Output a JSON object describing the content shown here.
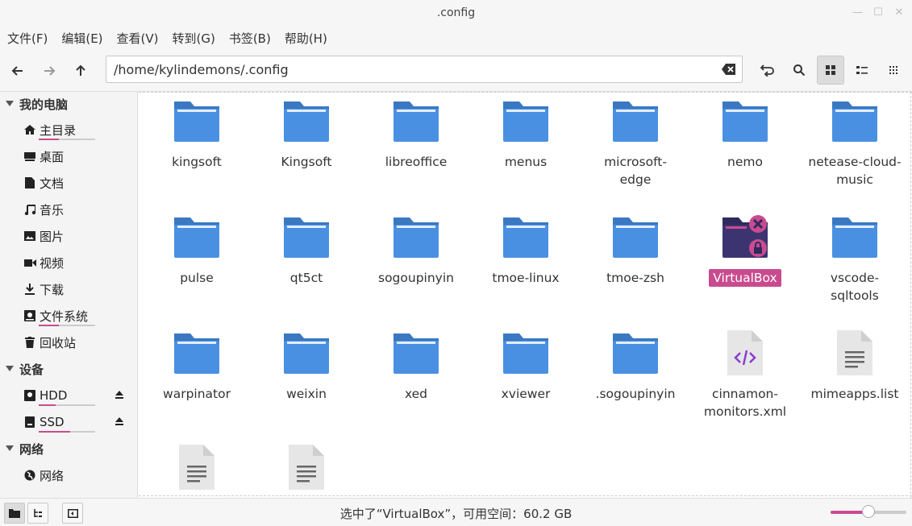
{
  "window": {
    "title": ".config"
  },
  "menu": [
    "文件(F)",
    "编辑(E)",
    "查看(V)",
    "转到(G)",
    "书签(B)",
    "帮助(H)"
  ],
  "address": {
    "path": "/home/kylindemons/.config"
  },
  "sidebar": {
    "sections": [
      {
        "title": "我的电脑",
        "items": [
          {
            "label": "主目录",
            "icon": "home-icon",
            "usage": 0.35
          },
          {
            "label": "桌面",
            "icon": "desktop-icon"
          },
          {
            "label": "文档",
            "icon": "document-icon"
          },
          {
            "label": "音乐",
            "icon": "music-icon"
          },
          {
            "label": "图片",
            "icon": "picture-icon"
          },
          {
            "label": "视频",
            "icon": "video-icon"
          },
          {
            "label": "下载",
            "icon": "download-icon"
          },
          {
            "label": "文件系统",
            "icon": "drive-icon",
            "usage": 0.35
          },
          {
            "label": "回收站",
            "icon": "trash-icon"
          }
        ]
      },
      {
        "title": "设备",
        "items": [
          {
            "label": "HDD",
            "icon": "hdd-icon",
            "usage": 0.3,
            "eject": true
          },
          {
            "label": "SSD",
            "icon": "ssd-icon",
            "usage": 0.55,
            "eject": true
          }
        ]
      },
      {
        "title": "网络",
        "items": [
          {
            "label": "网络",
            "icon": "network-icon"
          }
        ]
      }
    ]
  },
  "files": [
    {
      "name": "kingsoft",
      "type": "folder"
    },
    {
      "name": "Kingsoft",
      "type": "folder"
    },
    {
      "name": "libreoffice",
      "type": "folder"
    },
    {
      "name": "menus",
      "type": "folder"
    },
    {
      "name": "microsoft-edge",
      "type": "folder"
    },
    {
      "name": "nemo",
      "type": "folder"
    },
    {
      "name": "netease-cloud-music",
      "type": "folder"
    },
    {
      "name": "pulse",
      "type": "folder"
    },
    {
      "name": "qt5ct",
      "type": "folder"
    },
    {
      "name": "sogoupinyin",
      "type": "folder"
    },
    {
      "name": "tmoe-linux",
      "type": "folder"
    },
    {
      "name": "tmoe-zsh",
      "type": "folder"
    },
    {
      "name": "VirtualBox",
      "type": "locked-folder",
      "selected": true
    },
    {
      "name": "vscode-sqltools",
      "type": "folder"
    },
    {
      "name": "warpinator",
      "type": "folder"
    },
    {
      "name": "weixin",
      "type": "folder"
    },
    {
      "name": "xed",
      "type": "folder"
    },
    {
      "name": "xviewer",
      "type": "folder"
    },
    {
      "name": ".sogoupinyin",
      "type": "folder"
    },
    {
      "name": "cinnamon-monitors.xml",
      "type": "xml"
    },
    {
      "name": "mimeapps.list",
      "type": "text"
    },
    {
      "name": "",
      "type": "text"
    },
    {
      "name": "",
      "type": "text"
    }
  ],
  "status": {
    "text": "选中了“VirtualBox”，可用空间：60.2 GB",
    "zoom": 0.5
  },
  "colors": {
    "accent": "#c94b8f",
    "folder": "#4a90e2",
    "folder_tab": "#3a78c2"
  }
}
